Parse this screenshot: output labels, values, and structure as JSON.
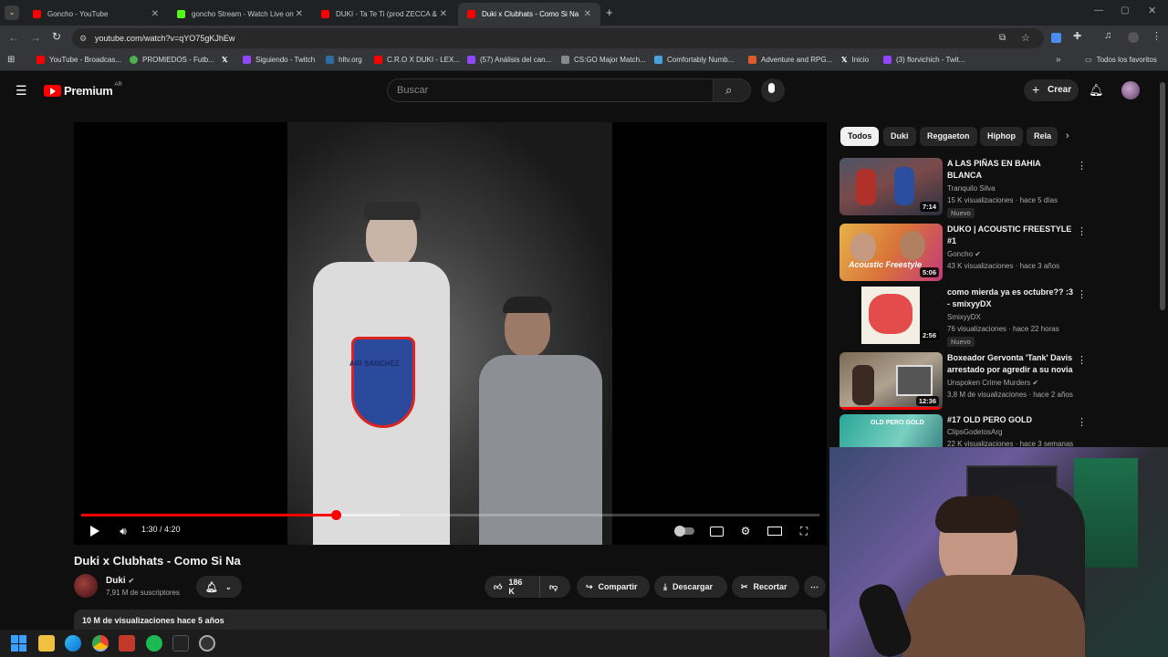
{
  "browser": {
    "tabs": [
      {
        "title": "Goncho - YouTube",
        "color": "#ff0000"
      },
      {
        "title": "goncho Stream - Watch Live on",
        "color": "#53fc18"
      },
      {
        "title": "DUKI - Ta Te Ti (prod ZECCA &",
        "color": "#ff0000"
      },
      {
        "title": "Duki x Clubhats - Como Si Na",
        "color": "#ff0000"
      }
    ],
    "url": "youtube.com/watch?v=qYO75gKJhEw",
    "bookmarks": [
      {
        "label": "YouTube - Broadcas...",
        "color": "#ff0000"
      },
      {
        "label": "PROMIEDOS - Futb...",
        "color": "#4caf50"
      },
      {
        "label": "",
        "icon": "x-icon",
        "color": "#000000"
      },
      {
        "label": "Siguiendo - Twitch",
        "color": "#9146ff"
      },
      {
        "label": "hltv.org",
        "color": "#2d6da3"
      },
      {
        "label": "C.R.O X DUKI - LEX...",
        "color": "#ff0000"
      },
      {
        "label": "(57) Análisis del can...",
        "color": "#9146ff"
      },
      {
        "label": "CS:GO Major Match...",
        "color": "#888888"
      },
      {
        "label": "Comfortably Numb...",
        "color": "#4aa3df"
      },
      {
        "label": "Adventure and RPG...",
        "color": "#e05a2b"
      },
      {
        "label": "Inicio",
        "color": "#000000"
      },
      {
        "label": "(3) florvichich - Twit...",
        "color": "#9146ff"
      }
    ],
    "all_bookmarks_label": "Todos los favoritos"
  },
  "header": {
    "logo_text": "Premium",
    "region": "AR",
    "search_placeholder": "Buscar",
    "create_label": "Crear"
  },
  "player": {
    "current_time": "1:30",
    "duration": "4:20",
    "timecode": "1:30 / 4:20",
    "progress_fraction": 0.346,
    "buffered_fraction": 0.431
  },
  "video": {
    "title": "Duki x Clubhats - Como Si Na",
    "channel": "Duki",
    "subscribers": "7,91 M de suscriptores",
    "likes": "186 K",
    "share_label": "Compartir",
    "download_label": "Descargar",
    "clip_label": "Recortar",
    "stats": "10 M de visualizaciones  hace 5 años"
  },
  "chips": [
    "Todos",
    "Duki",
    "Reggaeton",
    "Hiphop",
    "Rela"
  ],
  "recommendations": [
    {
      "title": "A LAS PIÑAS EN BAHIA BLANCA",
      "channel": "Tranquilo Silva",
      "meta": "15 K visualizaciones · hace 5 días",
      "duration": "7:14",
      "badge": "Nuevo",
      "verified": false
    },
    {
      "title": "DUKO | ACOUSTIC FREESTYLE #1",
      "channel": "Goncho",
      "meta": "43 K visualizaciones · hace 3 años",
      "duration": "5:06",
      "badge": "",
      "verified": true
    },
    {
      "title": "como mierda ya es octubre?? :3 - smixyyDX",
      "channel": "SmixyyDX",
      "meta": "76 visualizaciones · hace 22 horas",
      "duration": "2:56",
      "badge": "Nuevo",
      "verified": false
    },
    {
      "title": "Boxeador Gervonta 'Tank' Davis arrestado por agredir a su novia",
      "channel": "Unspoken Crime Murders",
      "meta": "3,8 M de visualizaciones · hace 2 años",
      "duration": "12:36",
      "badge": "",
      "verified": true
    },
    {
      "title": "#17 OLD PERO GOLD",
      "channel": "ClipsGodetosArg",
      "meta": "22 K visualizaciones · hace 3 semanas",
      "duration": "",
      "badge": "",
      "verified": false
    }
  ],
  "colors": {
    "accent": "#ff0000",
    "bg": "#0f0f0f",
    "surface": "#272727"
  }
}
